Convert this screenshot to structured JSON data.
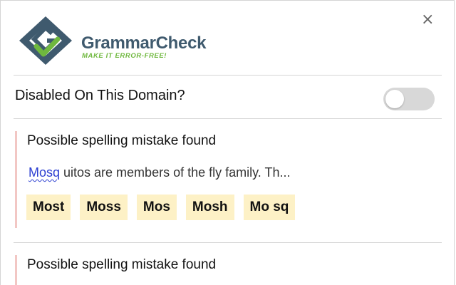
{
  "header": {
    "brand_name": "GrammarCheck",
    "tagline": "MAKE IT ERROR-FREE!",
    "close_label": "×"
  },
  "domain_setting": {
    "label": "Disabled On This Domain?",
    "enabled": false
  },
  "mistakes": [
    {
      "title": "Possible spelling mistake found",
      "context_error": "Mosq",
      "context_rest": " uitos are members of the fly family. Th...",
      "suggestions": [
        "Most",
        "Moss",
        "Mos",
        "Mosh",
        "Mo sq"
      ]
    },
    {
      "title": "Possible spelling mistake found"
    }
  ],
  "colors": {
    "brand_dark": "#3f5a6e",
    "brand_green": "#6fb83e",
    "error_blue": "#2c3fd1",
    "suggestion_bg": "#fdf1c6",
    "card_accent": "#f2c7c4",
    "toggle_off": "#d8d8d8"
  }
}
